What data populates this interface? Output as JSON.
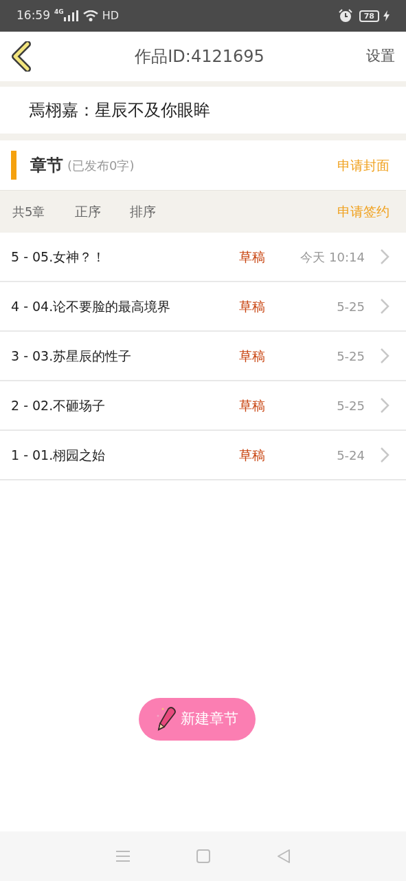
{
  "status_bar": {
    "time": "16:59",
    "network": "4G",
    "hd": "HD",
    "battery": "78"
  },
  "header": {
    "title": "作品ID:4121695",
    "action": "设置"
  },
  "work_title": "焉栩嘉：星辰不及你眼眸",
  "section": {
    "title": "章节",
    "subtitle": "(已发布0字)",
    "action": "申请封面"
  },
  "toolbar": {
    "count": "共5章",
    "options": [
      "正序",
      "排序"
    ],
    "action": "申请签约"
  },
  "chapters": [
    {
      "title": "5 - 05.女神？！",
      "status": "草稿",
      "date": "今天 10:14"
    },
    {
      "title": "4 - 04.论不要脸的最高境界",
      "status": "草稿",
      "date": "5-25"
    },
    {
      "title": "3 - 03.苏星辰的性子",
      "status": "草稿",
      "date": "5-25"
    },
    {
      "title": "2 - 02.不砸场子",
      "status": "草稿",
      "date": "5-25"
    },
    {
      "title": "1 - 01.栩园之始",
      "status": "草稿",
      "date": "5-24"
    }
  ],
  "new_chapter_button": "新建章节"
}
